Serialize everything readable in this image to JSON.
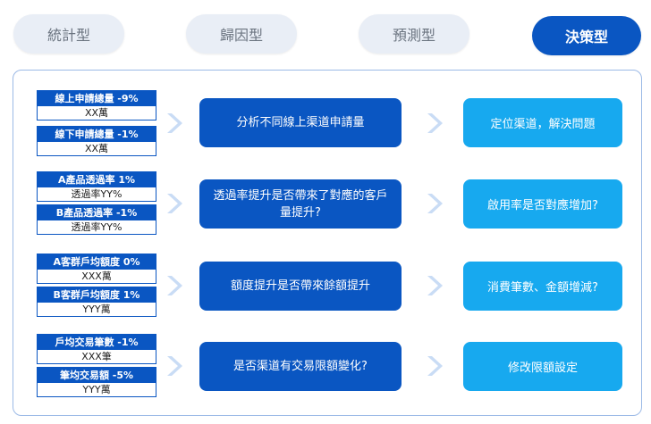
{
  "tabs": [
    {
      "label": "統計型"
    },
    {
      "label": "歸因型"
    },
    {
      "label": "預測型"
    },
    {
      "label": "決策型"
    }
  ],
  "rows": [
    {
      "metrics": [
        {
          "title": "線上申請總量 -9%",
          "value": "XX萬"
        },
        {
          "title": "線下申請總量 -1%",
          "value": "XX萬"
        }
      ],
      "analysis": "分析不同線上渠道申請量",
      "action": "定位渠道，解決問題"
    },
    {
      "metrics": [
        {
          "title": "A產品透過率 1%",
          "value": "透過率YY%"
        },
        {
          "title": "B產品透過率 -1%",
          "value": "透過率YY%"
        }
      ],
      "analysis": "透過率提升是否帶來了對應的客戶量提升?",
      "action": "啟用率是否對應增加?"
    },
    {
      "metrics": [
        {
          "title": "A客群戶均額度 0%",
          "value": "XXX萬"
        },
        {
          "title": "B客群戶均額度 1%",
          "value": "YYY萬"
        }
      ],
      "analysis": "額度提升是否帶來餘額提升",
      "action": "消費筆數、金額增減?"
    },
    {
      "metrics": [
        {
          "title": "戶均交易筆數 -1%",
          "value": "XXX筆"
        },
        {
          "title": "筆均交易額 -5%",
          "value": "YYY萬"
        }
      ],
      "analysis": "是否渠道有交易限額變化?",
      "action": "修改限額設定"
    }
  ],
  "colors": {
    "primary": "#0a56c2",
    "secondary": "#17a9ef",
    "tab_bg": "#e9eef6",
    "border": "#9bb9e6"
  }
}
